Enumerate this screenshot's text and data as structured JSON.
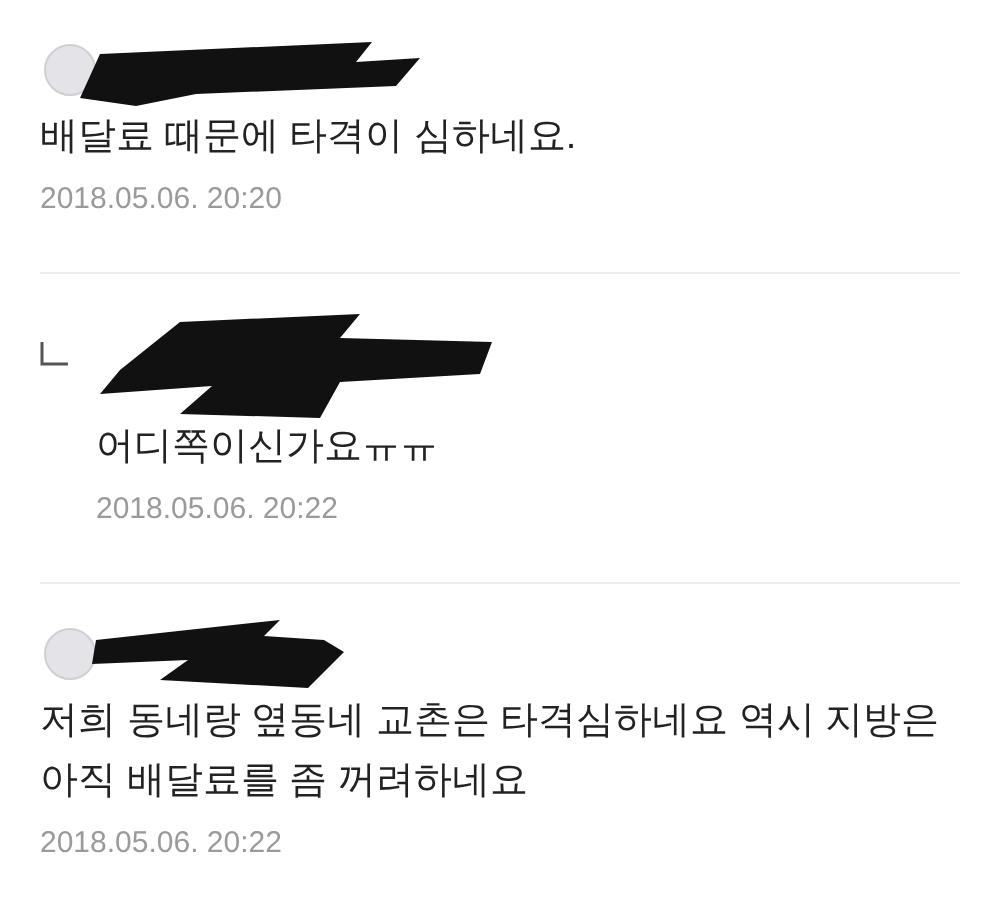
{
  "comments": [
    {
      "kind": "comment",
      "text": "배달료 때문에 타격이 심하네요.",
      "date": "2018.05.06. 20:20"
    },
    {
      "kind": "reply",
      "text": "어디쪽이신가요ㅠㅠ",
      "date": "2018.05.06. 20:22"
    },
    {
      "kind": "comment",
      "text": "저희 동네랑 옆동네 교촌은 타격심하네요 역시 지방은 아직 배달료를 좀 꺼려하네요",
      "date": "2018.05.06. 20:22"
    }
  ]
}
